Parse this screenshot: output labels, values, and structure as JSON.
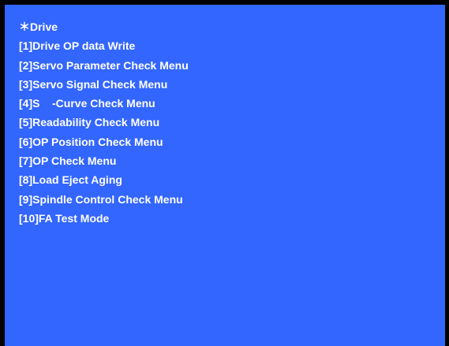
{
  "menu": {
    "title": "＊Drive",
    "items": [
      {
        "label": "[1]Drive OP data Write"
      },
      {
        "label": "[2]Servo Parameter Check Menu"
      },
      {
        "label": "[3]Servo Signal Check Menu"
      },
      {
        "label": "[4]S    -Curve Check Menu"
      },
      {
        "label": "[5]Readability Check Menu"
      },
      {
        "label": "[6]OP Position Check Menu"
      },
      {
        "label": "[7]OP Check Menu"
      },
      {
        "label": "[8]Load Eject Aging"
      },
      {
        "label": "[9]Spindle Control Check Menu"
      },
      {
        "label": "[10]FA Test Mode"
      }
    ]
  },
  "colors": {
    "background": "#3366ff",
    "frame": "#000000",
    "text": "#ffffff"
  }
}
